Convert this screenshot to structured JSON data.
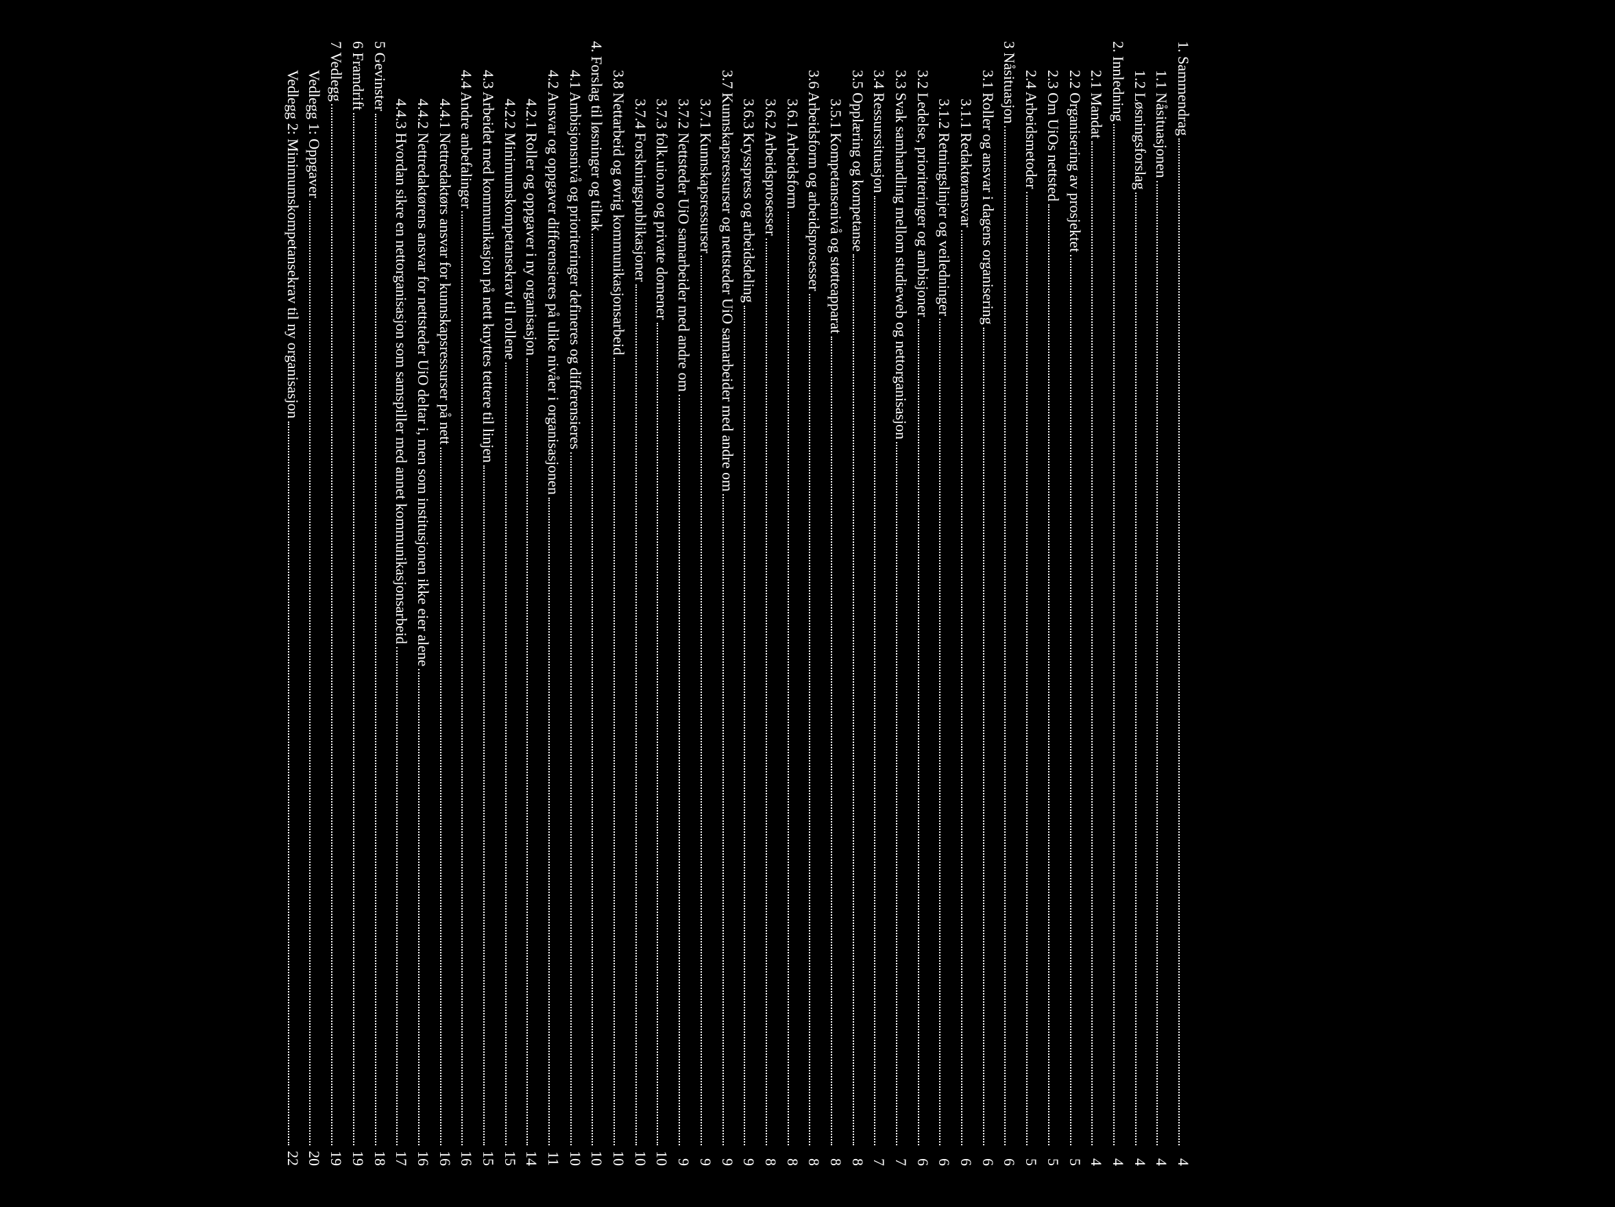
{
  "toc": [
    {
      "indent": 0,
      "num": "1.",
      "title": "Sammendrag",
      "page": "4"
    },
    {
      "indent": 1,
      "num": "1.1",
      "title": "Nåsituasjonen",
      "page": "4"
    },
    {
      "indent": 1,
      "num": "1.2",
      "title": "Løsningsforslag",
      "page": "4"
    },
    {
      "indent": 0,
      "num": "2.",
      "title": "Innledning",
      "page": "4"
    },
    {
      "indent": 1,
      "num": "2.1",
      "title": "Mandat",
      "page": "4"
    },
    {
      "indent": 1,
      "num": "2.2",
      "title": "Organisering av prosjektet",
      "page": "5"
    },
    {
      "indent": 1,
      "num": "2.3",
      "title": "Om UiOs nettsted",
      "page": "5"
    },
    {
      "indent": 1,
      "num": "2.4",
      "title": "Arbeidsmetoder",
      "page": "5"
    },
    {
      "indent": 0,
      "num": "3",
      "title": "Nåsituasjon",
      "page": "6"
    },
    {
      "indent": 1,
      "num": "3.1",
      "title": "Roller og ansvar i dagens organisering",
      "page": "6"
    },
    {
      "indent": 2,
      "num": "3.1.1",
      "title": "Redaktøransvar",
      "page": "6"
    },
    {
      "indent": 2,
      "num": "3.1.2",
      "title": "Retningslinjer og veiledninger",
      "page": "6"
    },
    {
      "indent": 1,
      "num": "3.2",
      "title": "Ledelse, prioriteringer og ambisjoner",
      "page": "6"
    },
    {
      "indent": 1,
      "num": "3.3",
      "title": "Svak samhandling mellom studieweb og nettorganisasjon",
      "page": "7"
    },
    {
      "indent": 1,
      "num": "3.4",
      "title": "Ressurssituasjon",
      "page": "7"
    },
    {
      "indent": 1,
      "num": "3.5",
      "title": "Opplæring og kompetanse",
      "page": "8"
    },
    {
      "indent": 2,
      "num": "3.5.1",
      "title": "Kompetansenivå og støtteapparat",
      "page": "8"
    },
    {
      "indent": 1,
      "num": "3.6",
      "title": "Arbeidsform og arbeidsprosesser",
      "page": "8"
    },
    {
      "indent": 2,
      "num": "3.6.1",
      "title": "Arbeidsform",
      "page": "8"
    },
    {
      "indent": 2,
      "num": "3.6.2",
      "title": "Arbeidsprosesser",
      "page": "8"
    },
    {
      "indent": 2,
      "num": "3.6.3",
      "title": "Krysspress og arbeidsdeling",
      "page": "9"
    },
    {
      "indent": 1,
      "num": "3.7",
      "title": "Kunnskapsressurser og nettsteder UiO samarbeider med andre om",
      "page": "9"
    },
    {
      "indent": 2,
      "num": "3.7.1",
      "title": "Kunnskapsressurser",
      "page": "9"
    },
    {
      "indent": 2,
      "num": "3.7.2",
      "title": "Nettsteder UiO samarbeider med andre om",
      "page": "9"
    },
    {
      "indent": 2,
      "num": "3.7.3",
      "title": "folk.uio.no og private domener",
      "page": "10"
    },
    {
      "indent": 2,
      "num": "3.7.4",
      "title": "Forskningspublikasjoner",
      "page": "10"
    },
    {
      "indent": 1,
      "num": "3.8",
      "title": "Nettarbeid og øvrig kommunikasjonsarbeid",
      "page": "10"
    },
    {
      "indent": 0,
      "num": "4.",
      "title": "Forslag til løsninger og tiltak",
      "page": "10"
    },
    {
      "indent": 1,
      "num": "4.1",
      "title": "Ambisjonsnivå og prioriteringer defineres og differensieres",
      "page": "10"
    },
    {
      "indent": 1,
      "num": "4.2",
      "title": "Ansvar og oppgaver differensieres på ulike nivåer i organisasjonen",
      "page": "11"
    },
    {
      "indent": 2,
      "num": "4.2.1",
      "title": "Roller og oppgaver i ny organisasjon",
      "page": "14"
    },
    {
      "indent": 2,
      "num": "4.2.2",
      "title": "Minimumskompetansekrav til rollene",
      "page": "15"
    },
    {
      "indent": 1,
      "num": "4.3",
      "title": "Arbeidet med kommunikasjon på nett knyttes tettere til linjen",
      "page": "15"
    },
    {
      "indent": 1,
      "num": "4.4",
      "title": "Andre anbefalinger",
      "page": "16"
    },
    {
      "indent": 2,
      "num": "4.4.1",
      "title": "Nettredaktørs ansvar for kunnskapsressurser på nett",
      "page": "16"
    },
    {
      "indent": 2,
      "num": "4.4.2",
      "title": "Nettredaktørens ansvar for nettsteder UiO deltar i, men som institusjonen ikke eier alene",
      "page": "16"
    },
    {
      "indent": 2,
      "num": "4.4.3",
      "title": "Hvordan sikre en nettorganisasjon som samspiller med annet kommunikasjonsarbeid",
      "page": "17"
    },
    {
      "indent": 0,
      "num": "5",
      "title": "Gevinster",
      "page": "18"
    },
    {
      "indent": 0,
      "num": "6",
      "title": "Framdrift",
      "page": "19"
    },
    {
      "indent": 0,
      "num": "7",
      "title": "Vedlegg",
      "page": "19"
    },
    {
      "indent": 1,
      "num": "",
      "title": "Vedlegg 1: Oppgaver",
      "page": "20"
    },
    {
      "indent": 1,
      "num": "",
      "title": "Vedlegg 2: Minimumskompetansekrav til ny organisasjon",
      "page": "22"
    }
  ]
}
